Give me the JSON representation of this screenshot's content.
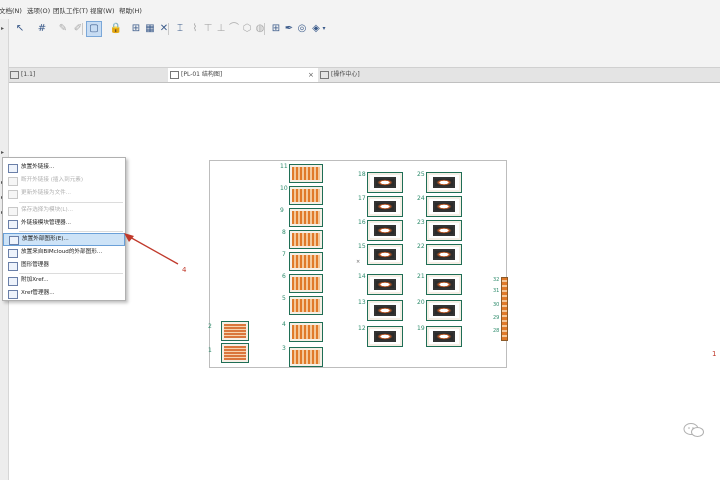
{
  "menubar": {
    "items": [
      "文档(N)",
      "选项(O)",
      "团队工作(T)",
      "视窗(W)",
      "帮助(H)"
    ]
  },
  "tabs": [
    {
      "label": "[1.1]",
      "active": false
    },
    {
      "label": "[PL-01 结构图]",
      "active": true
    },
    {
      "label": "[操作中心]",
      "active": false
    }
  ],
  "tab_close": "×",
  "context_menu": {
    "items": [
      {
        "label": "放置外链接...",
        "enabled": true,
        "highlighted": false
      },
      {
        "label": "断开外链接 (插入到元素)",
        "enabled": false,
        "highlighted": false
      },
      {
        "label": "更新外链接为文件...",
        "enabled": false,
        "highlighted": false
      },
      {
        "label": "保存选择为模块(L)...",
        "enabled": false,
        "highlighted": false
      },
      {
        "label": "外链接模块管理器...",
        "enabled": true,
        "highlighted": false
      },
      {
        "label": "放置外部图形(E)...",
        "enabled": true,
        "highlighted": true
      },
      {
        "label": "放置来自BIMcloud的外部图形...",
        "enabled": true,
        "highlighted": false
      },
      {
        "label": "图形管理器",
        "enabled": true,
        "highlighted": false
      },
      {
        "label": "附加Xref...",
        "enabled": true,
        "highlighted": false
      },
      {
        "label": "Xref管理器...",
        "enabled": true,
        "highlighted": false
      }
    ]
  },
  "annotation": {
    "step_label": "4",
    "edge_label": "1",
    "color": "#c0392b"
  },
  "sheet": {
    "col1_labels": [
      "11",
      "10",
      "9",
      "8",
      "7",
      "6",
      "5",
      "4",
      "3"
    ],
    "col0_labels": [
      "2",
      "1"
    ],
    "col2_labels": [
      "18",
      "17",
      "16",
      "15",
      "14",
      "13",
      "12"
    ],
    "col3_labels": [
      "25",
      "24",
      "23",
      "22",
      "21",
      "20",
      "19"
    ],
    "right_labels": [
      "32",
      "31",
      "30",
      "29",
      "28"
    ]
  },
  "colors": {
    "accent": "#2b8a6a",
    "frame": "#1f6e55",
    "orange": "#e07a2a",
    "highlight": "#cde3f7"
  }
}
